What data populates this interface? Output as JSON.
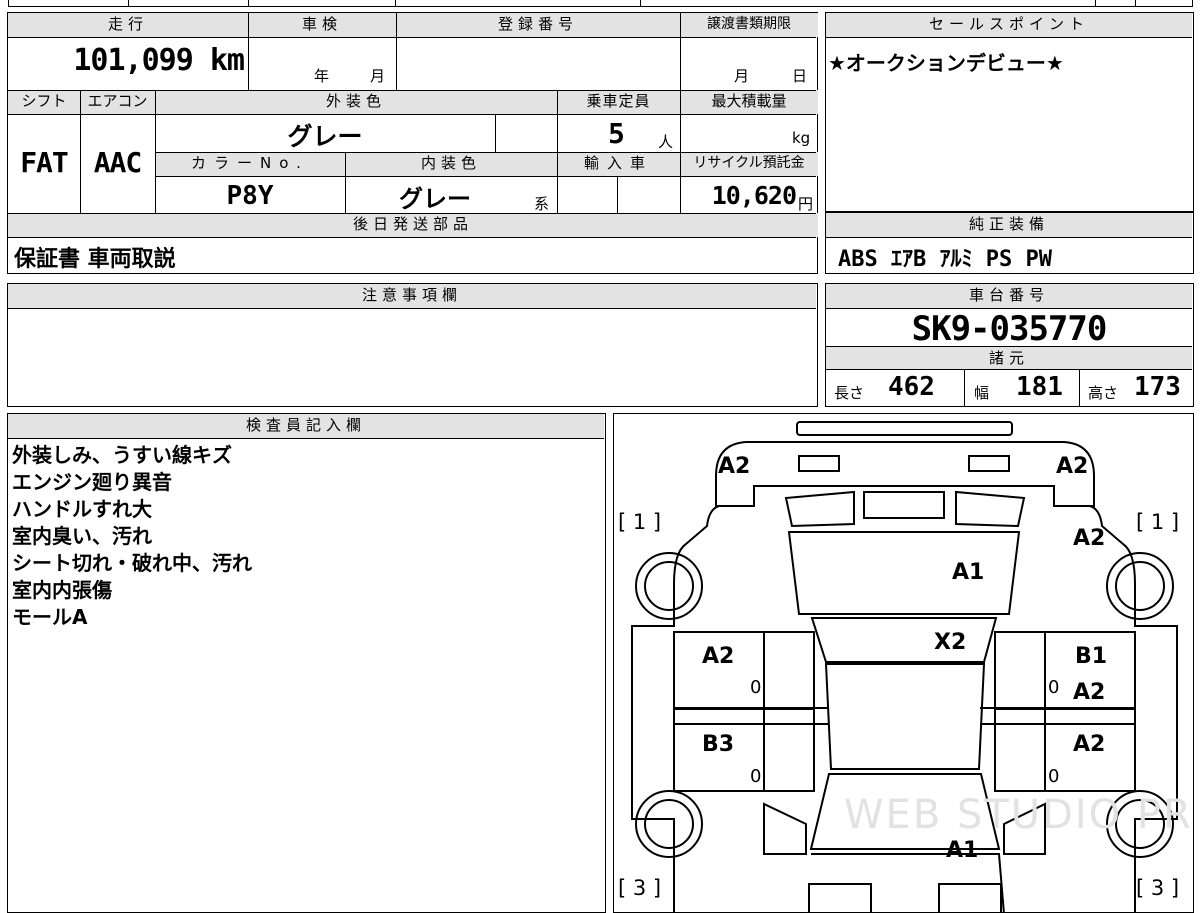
{
  "mileage": {
    "header": "走行",
    "value": "101,099 km"
  },
  "inspection": {
    "header": "車検",
    "year_unit": "年",
    "month_unit": "月"
  },
  "registration": {
    "header": "登録番号",
    "value": ""
  },
  "transfer_deadline": {
    "header": "譲渡書類期限",
    "month_unit": "月",
    "day_unit": "日"
  },
  "sales_point": {
    "header": "セールスポイント",
    "text": "★オークションデビュー★"
  },
  "shift": {
    "header": "シフト",
    "value": "FAT"
  },
  "aircon": {
    "header": "エアコン",
    "value": "AAC"
  },
  "exterior_color": {
    "header": "外装色",
    "value": "グレー"
  },
  "capacity": {
    "header": "乗車定員",
    "value": "5",
    "unit": "人"
  },
  "max_load": {
    "header": "最大積載量",
    "unit": "kg"
  },
  "color_no": {
    "header": "カラーNo.",
    "value": "P8Y"
  },
  "interior_color": {
    "header": "内装色",
    "value": "グレー",
    "suffix": "系"
  },
  "import": {
    "header": "輸入車"
  },
  "recycle": {
    "header": "リサイクル預託金",
    "value": "10,620",
    "unit": "円"
  },
  "later_parts": {
    "header": "後日発送部品",
    "value": "保証書 車両取説"
  },
  "genuine_equipment": {
    "header": "純正装備",
    "value": "ABS ｴｱB ｱﾙﾐ PS PW"
  },
  "notes": {
    "header": "注意事項欄"
  },
  "chassis": {
    "header": "車台番号",
    "value": "SK9-035770"
  },
  "specs": {
    "header": "諸元",
    "length_label": "長さ",
    "length": "462",
    "width_label": "幅",
    "width": "181",
    "height_label": "高さ",
    "height": "173"
  },
  "inspector": {
    "header": "検査員記入欄",
    "lines": [
      "外装しみ、うすい線キズ",
      "エンジン廻り異音",
      "ハンドルすれ大",
      "室内臭い、汚れ",
      "シート切れ・破れ中、汚れ",
      "室内内張傷",
      "モールA"
    ]
  },
  "diagram": {
    "labels": {
      "front_left": "A2",
      "front_right": "A2",
      "fender_right": "A2",
      "hood": "A1",
      "windshield": "X2",
      "door_fl": "A2",
      "door_fr_1": "B1",
      "door_fr_2": "A2",
      "door_rl": "B3",
      "door_rr": "A2",
      "rear": "A1"
    },
    "tires": {
      "fl": "[ 1 ]",
      "fr": "[ 1 ]",
      "rl": "[ 3 ]",
      "rr": "[ 3 ]"
    },
    "zeros": {
      "fl": "0",
      "fr": "0",
      "rl": "0",
      "rr": "0"
    },
    "watermark": "WEB STUDIO PRO"
  }
}
